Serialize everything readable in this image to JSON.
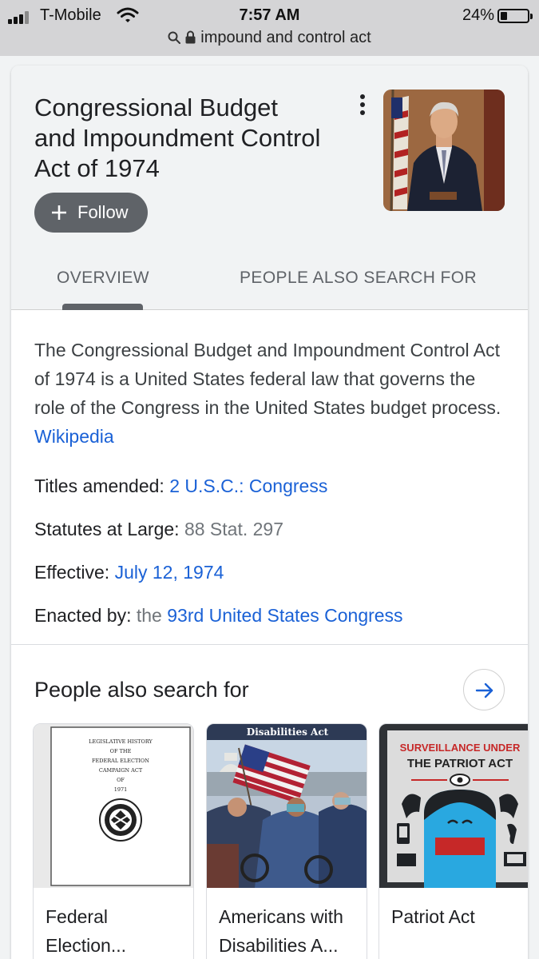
{
  "status_bar": {
    "carrier": "T-Mobile",
    "time": "7:57 AM",
    "battery": "24%",
    "battery_level": 0.24
  },
  "address_bar": {
    "query": "impound and control act"
  },
  "entity": {
    "title": "Congressional Budget and Impoundment Control Act of 1974",
    "follow_label": "Follow"
  },
  "tabs": [
    {
      "label": "OVERVIEW",
      "active": true
    },
    {
      "label": "PEOPLE ALSO SEARCH FOR",
      "active": false
    }
  ],
  "description": {
    "text": "The Congressional Budget and Impoundment Control Act of 1974 is a United States federal law that governs the role of the Congress in the United States budget process. ",
    "source": "Wikipedia"
  },
  "facts": [
    {
      "label": "Titles amended: ",
      "prefix": "",
      "value": "2 U.S.C.: Congress",
      "value_style": "link"
    },
    {
      "label": "Statutes at Large: ",
      "prefix": "",
      "value": "88 Stat. 297",
      "value_style": "grey"
    },
    {
      "label": "Effective: ",
      "prefix": "",
      "value": "July 12, 1974",
      "value_style": "link"
    },
    {
      "label": "Enacted by: ",
      "prefix": "the ",
      "value": "93rd United States Congress",
      "value_style": "link"
    }
  ],
  "people_also_search": {
    "title": "People also search for",
    "items": [
      {
        "label": "Federal Election...",
        "image_text": [
          "LEGISLATIVE HISTORY",
          "OF THE",
          "FEDERAL ELECTION",
          "CAMPAIGN ACT",
          "OF",
          "1971"
        ]
      },
      {
        "label": "Americans with Disabilities A...",
        "image_text": [
          "Disabilities Act"
        ]
      },
      {
        "label": "Patriot Act",
        "image_text": [
          "SURVEILLANCE UNDER",
          "THE PATRIOT ACT"
        ]
      }
    ]
  },
  "colors": {
    "link": "#1a61d6",
    "follow_button": "#5f6368",
    "header_bg": "#f1f3f4",
    "patriot_red": "#c62828",
    "patriot_blue": "#29a8e0"
  }
}
